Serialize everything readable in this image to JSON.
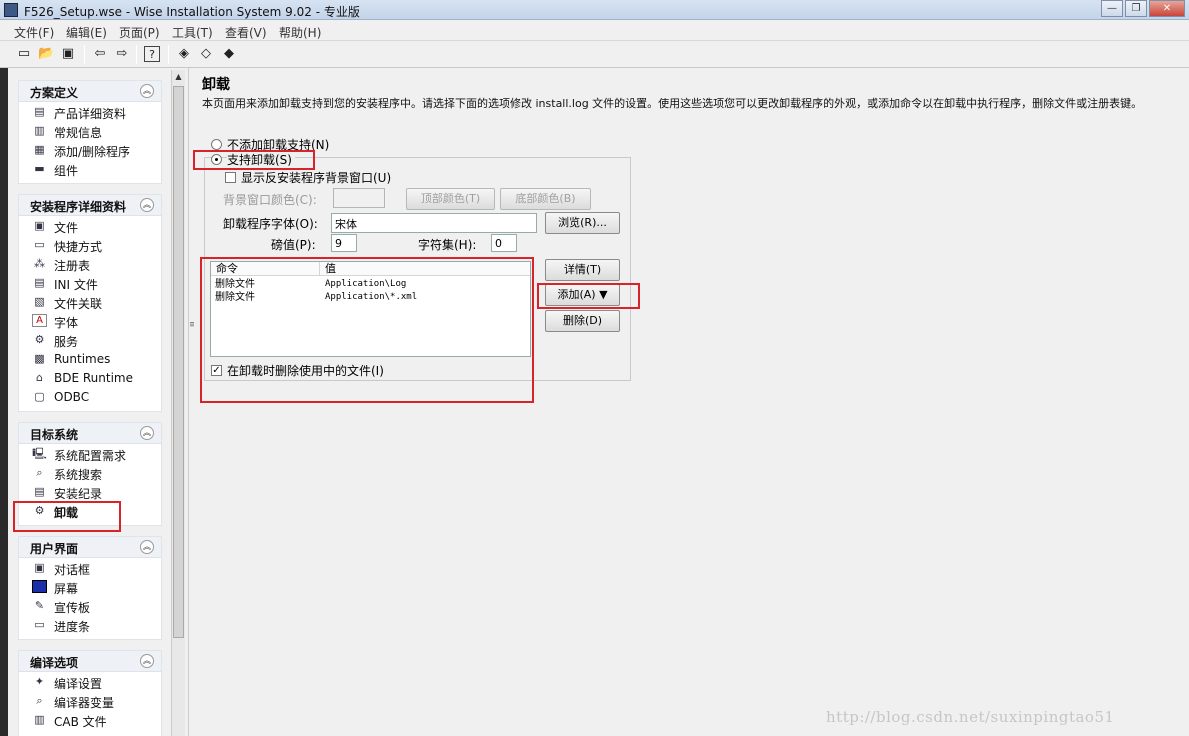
{
  "window": {
    "title": "F526_Setup.wse - Wise Installation System 9.02 - 专业版"
  },
  "menu": [
    "文件(F)",
    "编辑(E)",
    "页面(P)",
    "工具(T)",
    "查看(V)",
    "帮助(H)"
  ],
  "groups": [
    {
      "title": "方案定义",
      "items": [
        "产品详细资料",
        "常规信息",
        "添加/删除程序",
        "组件"
      ]
    },
    {
      "title": "安装程序详细资料",
      "items": [
        "文件",
        "快捷方式",
        "注册表",
        "INI 文件",
        "文件关联",
        "字体",
        "服务",
        "Runtimes",
        "BDE Runtime",
        "ODBC"
      ]
    },
    {
      "title": "目标系统",
      "items": [
        "系统配置需求",
        "系统搜索",
        "安装纪录",
        "卸载"
      ]
    },
    {
      "title": "用户界面",
      "items": [
        "对话框",
        "屏幕",
        "宣传板",
        "进度条"
      ]
    },
    {
      "title": "编译选项",
      "items": [
        "编译设置",
        "编译器变量",
        "CAB 文件"
      ]
    }
  ],
  "page": {
    "title": "卸载",
    "description": "本页面用来添加卸载支持到您的安装程序中。请选择下面的选项修改 install.log 文件的设置。使用这些选项您可以更改卸载程序的外观，或添加命令以在卸载中执行程序，删除文件或注册表键。",
    "radio_none": "不添加卸载支持(N)",
    "radio_support": "支持卸载(S)",
    "show_bg": "显示反安装程序背景窗口(U)",
    "bg_color_label": "背景窗口颜色(C):",
    "top_color": "顶部颜色(T)",
    "bottom_color": "底部颜色(B)",
    "font_label": "卸载程序字体(O):",
    "font_value": "宋体",
    "browse": "浏览(R)...",
    "pound_label": "磅值(P):",
    "pound_value": "9",
    "charset_label": "字符集(H):",
    "charset_value": "0",
    "list": {
      "col_command": "命令",
      "col_value": "值",
      "rows": [
        {
          "command": "删除文件",
          "value": "Application\\Log"
        },
        {
          "command": "删除文件",
          "value": "Application\\*.xml"
        }
      ]
    },
    "delete_in_use": "在卸载时删除使用中的文件(I)",
    "details": "详情(T)",
    "add": "添加(A)",
    "delete": "删除(D)"
  },
  "watermark": "http://blog.csdn.net/suxinpingtao51"
}
